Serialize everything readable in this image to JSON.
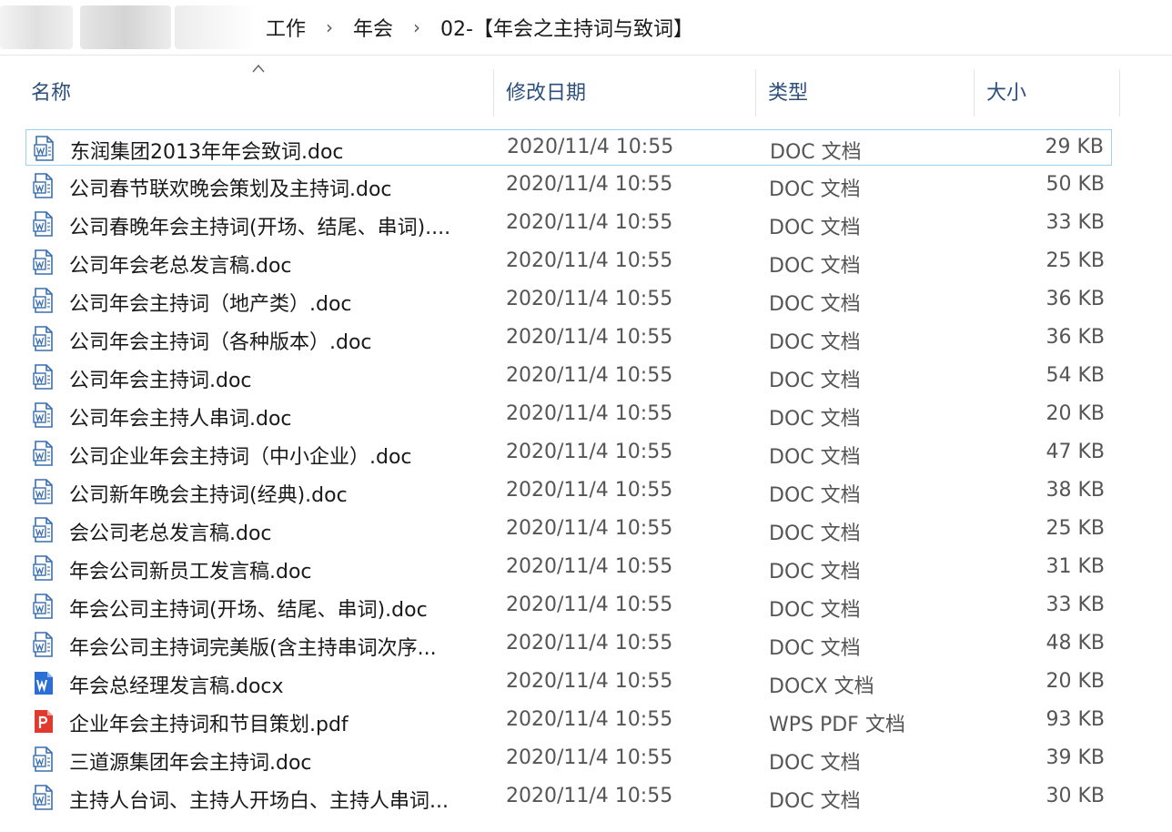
{
  "breadcrumb": [
    "工作",
    "年会",
    "02-【年会之主持词与致词】"
  ],
  "breadcrumb_separator": "›",
  "columns": {
    "name": "名称",
    "modified": "修改日期",
    "type": "类型",
    "size": "大小"
  },
  "sort_indicator": "^",
  "colors": {
    "header_text": "#2c4f7c",
    "doc_icon": "#3a6fb0",
    "docx_icon": "#2b6fd6",
    "pdf_icon": "#e03a2f",
    "selection_border": "#9fd1f3"
  },
  "files": [
    {
      "name": "东润集团2013年年会致词.doc",
      "modified": "2020/11/4 10:55",
      "type": "DOC 文档",
      "size": "29 KB",
      "icon": "doc-file-icon"
    },
    {
      "name": "公司春节联欢晚会策划及主持词.doc",
      "modified": "2020/11/4 10:55",
      "type": "DOC 文档",
      "size": "50 KB",
      "icon": "doc-file-icon"
    },
    {
      "name": "公司春晚年会主持词(开场、结尾、串词)....",
      "modified": "2020/11/4 10:55",
      "type": "DOC 文档",
      "size": "33 KB",
      "icon": "doc-file-icon"
    },
    {
      "name": "公司年会老总发言稿.doc",
      "modified": "2020/11/4 10:55",
      "type": "DOC 文档",
      "size": "25 KB",
      "icon": "doc-file-icon"
    },
    {
      "name": "公司年会主持词（地产类）.doc",
      "modified": "2020/11/4 10:55",
      "type": "DOC 文档",
      "size": "36 KB",
      "icon": "doc-file-icon"
    },
    {
      "name": "公司年会主持词（各种版本）.doc",
      "modified": "2020/11/4 10:55",
      "type": "DOC 文档",
      "size": "36 KB",
      "icon": "doc-file-icon"
    },
    {
      "name": "公司年会主持词.doc",
      "modified": "2020/11/4 10:55",
      "type": "DOC 文档",
      "size": "54 KB",
      "icon": "doc-file-icon"
    },
    {
      "name": "公司年会主持人串词.doc",
      "modified": "2020/11/4 10:55",
      "type": "DOC 文档",
      "size": "20 KB",
      "icon": "doc-file-icon"
    },
    {
      "name": "公司企业年会主持词（中小企业）.doc",
      "modified": "2020/11/4 10:55",
      "type": "DOC 文档",
      "size": "47 KB",
      "icon": "doc-file-icon"
    },
    {
      "name": "公司新年晚会主持词(经典).doc",
      "modified": "2020/11/4 10:55",
      "type": "DOC 文档",
      "size": "38 KB",
      "icon": "doc-file-icon"
    },
    {
      "name": "会公司老总发言稿.doc",
      "modified": "2020/11/4 10:55",
      "type": "DOC 文档",
      "size": "25 KB",
      "icon": "doc-file-icon"
    },
    {
      "name": "年会公司新员工发言稿.doc",
      "modified": "2020/11/4 10:55",
      "type": "DOC 文档",
      "size": "31 KB",
      "icon": "doc-file-icon"
    },
    {
      "name": "年会公司主持词(开场、结尾、串词).doc",
      "modified": "2020/11/4 10:55",
      "type": "DOC 文档",
      "size": "33 KB",
      "icon": "doc-file-icon"
    },
    {
      "name": "年会公司主持词完美版(含主持串词次序...",
      "modified": "2020/11/4 10:55",
      "type": "DOC 文档",
      "size": "48 KB",
      "icon": "doc-file-icon"
    },
    {
      "name": "年会总经理发言稿.docx",
      "modified": "2020/11/4 10:55",
      "type": "DOCX 文档",
      "size": "20 KB",
      "icon": "docx-file-icon"
    },
    {
      "name": "企业年会主持词和节目策划.pdf",
      "modified": "2020/11/4 10:55",
      "type": "WPS PDF 文档",
      "size": "93 KB",
      "icon": "pdf-file-icon"
    },
    {
      "name": "三道源集团年会主持词.doc",
      "modified": "2020/11/4 10:55",
      "type": "DOC 文档",
      "size": "39 KB",
      "icon": "doc-file-icon"
    },
    {
      "name": "主持人台词、主持人开场白、主持人串词...",
      "modified": "2020/11/4 10:55",
      "type": "DOC 文档",
      "size": "30 KB",
      "icon": "doc-file-icon"
    }
  ]
}
